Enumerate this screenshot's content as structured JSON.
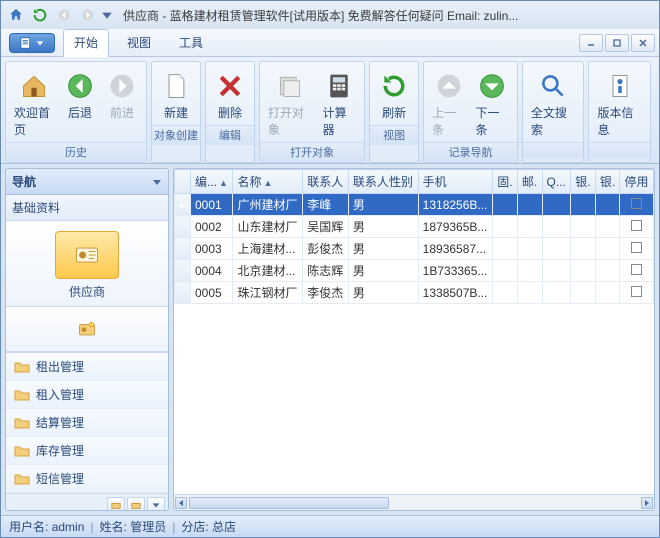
{
  "title": "供应商 - 蓝格建材租赁管理软件[试用版本] 免费解答任何疑问 Email: zulin...",
  "menu_tabs": {
    "start": "开始",
    "view": "视图",
    "tools": "工具"
  },
  "ribbon": {
    "history": {
      "home": "欢迎首页",
      "back": "后退",
      "forward": "前进",
      "title": "历史"
    },
    "create": {
      "new": "新建",
      "title": "对象创建"
    },
    "edit": {
      "delete": "删除",
      "title": "编辑"
    },
    "open": {
      "open_obj": "打开对象",
      "calc": "计算器",
      "title": "打开对象"
    },
    "viewg": {
      "refresh": "刷新",
      "title": "视图"
    },
    "recnav": {
      "prev": "上一条",
      "next": "下一条",
      "title": "记录导航"
    },
    "search": {
      "fulltext": "全文搜索"
    },
    "ver": {
      "version": "版本信息"
    }
  },
  "nav": {
    "title": "导航",
    "section": "基础资料",
    "supplier": "供应商",
    "items": [
      "租出管理",
      "租入管理",
      "结算管理",
      "库存管理",
      "短信管理"
    ]
  },
  "grid": {
    "cols": {
      "id": "编...",
      "name": "名称",
      "contact": "联系人",
      "gender": "联系人性别",
      "phone": "手机",
      "c6": "固.",
      "c7": "邮.",
      "c8": "Q...",
      "c9": "银.",
      "c10": "银.",
      "c11": "停用"
    },
    "rows": [
      {
        "id": "0001",
        "name": "广州建材厂",
        "contact": "李峰",
        "gender": "男",
        "phone": "1318256B...",
        "stopped": true
      },
      {
        "id": "0002",
        "name": "山东建材厂",
        "contact": "吴国辉",
        "gender": "男",
        "phone": "1879365B...",
        "stopped": false
      },
      {
        "id": "0003",
        "name": "上海建材...",
        "contact": "彭俊杰",
        "gender": "男",
        "phone": "18936587...",
        "stopped": false
      },
      {
        "id": "0004",
        "name": "北京建材...",
        "contact": "陈志辉",
        "gender": "男",
        "phone": "1B733365...",
        "stopped": false
      },
      {
        "id": "0005",
        "name": "珠江钢材厂",
        "contact": "李俊杰",
        "gender": "男",
        "phone": "1338507B...",
        "stopped": false
      }
    ]
  },
  "status": {
    "user_label": "用户名:",
    "user": "admin",
    "name_label": "姓名:",
    "name": "管理员",
    "branch_label": "分店:",
    "branch": "总店"
  }
}
